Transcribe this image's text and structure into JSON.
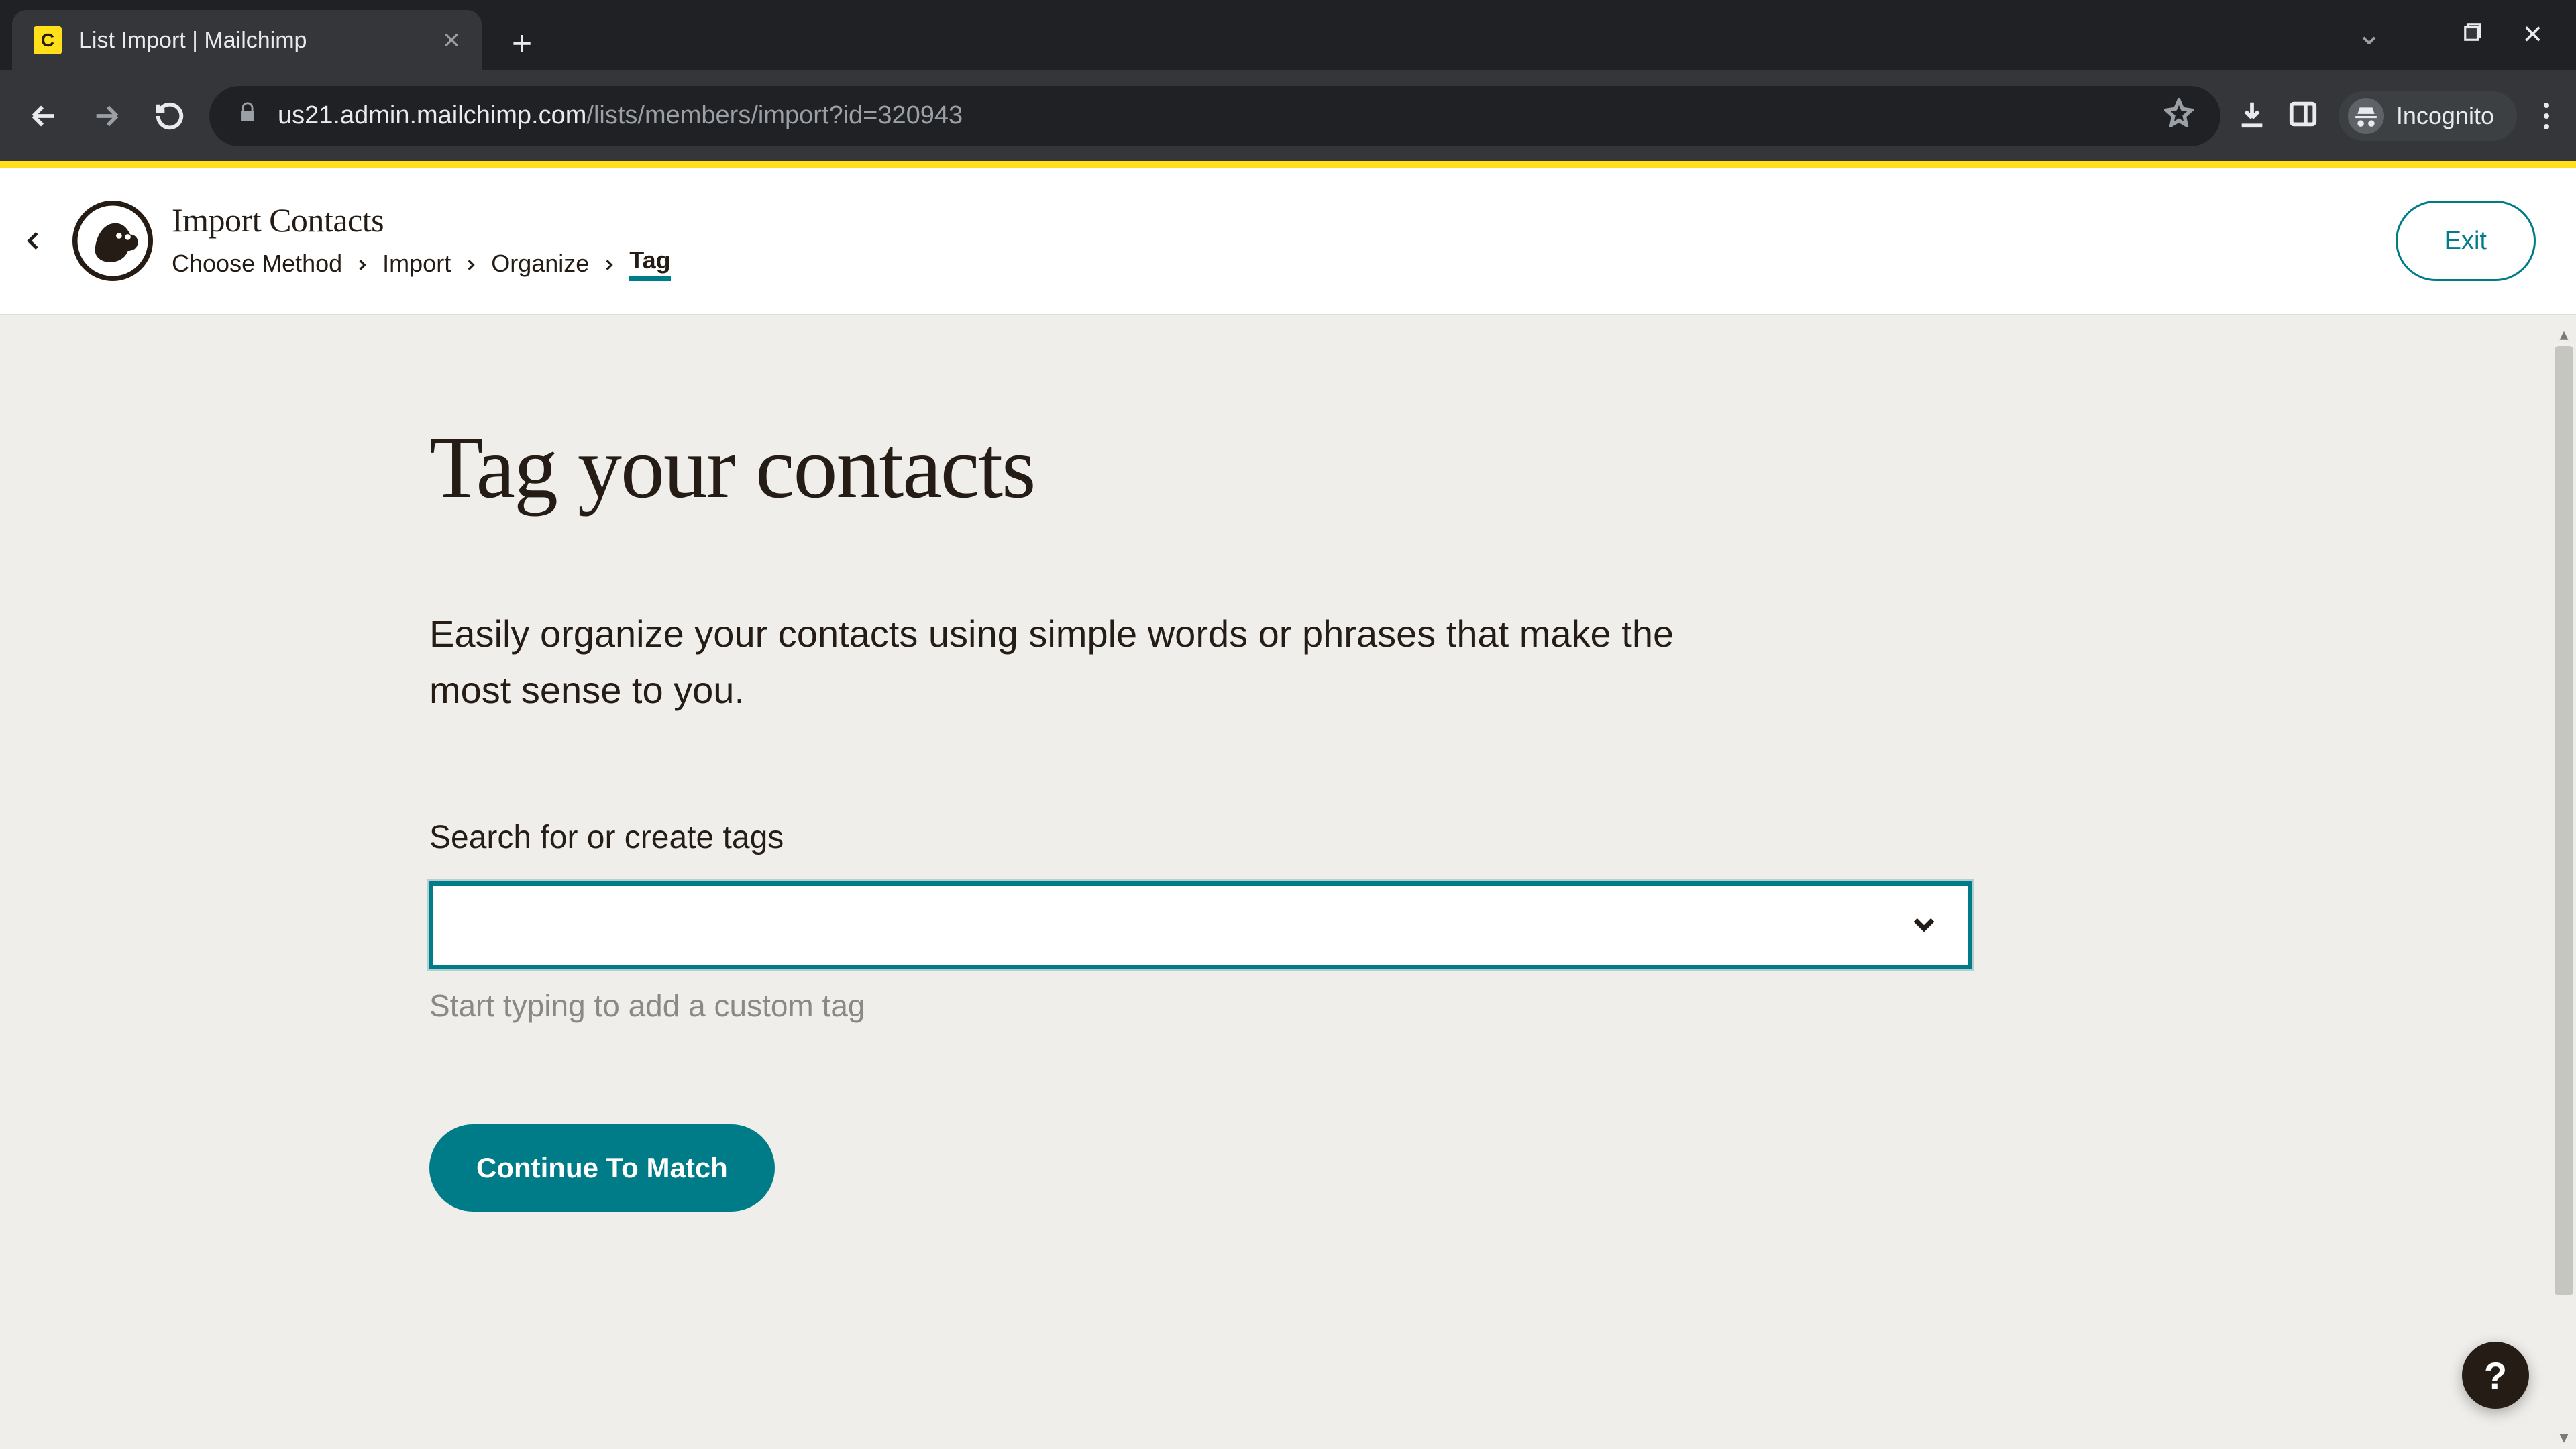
{
  "browser": {
    "tab": {
      "title": "List Import | Mailchimp",
      "favicon_letter": "C"
    },
    "url_host": "us21.admin.mailchimp.com",
    "url_path": "/lists/members/import?id=320943",
    "incognito_label": "Incognito"
  },
  "header": {
    "wizard_title": "Import Contacts",
    "breadcrumbs": [
      "Choose Method",
      "Import",
      "Organize",
      "Tag"
    ],
    "active_breadcrumb_index": 3,
    "exit_label": "Exit"
  },
  "main": {
    "title": "Tag your contacts",
    "subtitle": "Easily organize your contacts using simple words or phrases that make the most sense to you.",
    "field_label": "Search for or create tags",
    "input_value": "",
    "input_placeholder": "",
    "hint": "Start typing to add a custom tag",
    "submit_label": "Continue To Match"
  },
  "help_fab": "?"
}
